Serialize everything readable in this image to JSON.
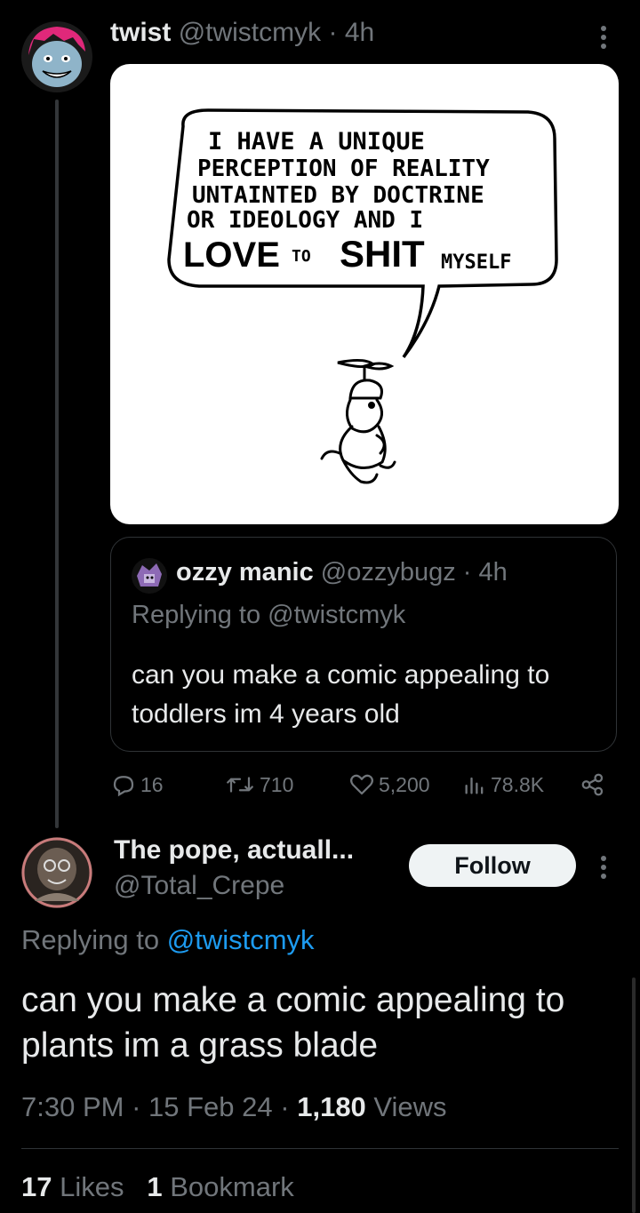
{
  "parent_tweet": {
    "display_name": "twist",
    "handle": "@twistcmyk",
    "separator": "·",
    "time": "4h",
    "avatar": "avatar-blue-face-pink-hair",
    "comic": {
      "speech_lines": [
        "I HAVE A UNIQUE",
        "PERCEPTION OF REALITY",
        "UNTAINTED BY DOCTRINE",
        "OR IDEOLOGY AND I"
      ],
      "speech_big_1": "LOVE",
      "speech_to": "TO",
      "speech_big_2": "SHIT",
      "speech_end": "MYSELF"
    },
    "quote": {
      "display_name": "ozzy manic",
      "handle": "@ozzybugz",
      "separator": "·",
      "time": "4h",
      "replying_prefix": "Replying to",
      "replying_handle": "@twistcmyk",
      "text": "can you make a comic appealing to toddlers im 4 years old"
    },
    "actions": {
      "replies": "16",
      "reposts": "710",
      "likes": "5,200",
      "views": "78.8K"
    }
  },
  "reply_tweet": {
    "display_name": "The pope, actuall...",
    "handle": "@Total_Crepe",
    "follow_label": "Follow",
    "replying_prefix": "Replying to",
    "replying_handle": "@twistcmyk",
    "text": "can you make a comic appealing to plants im a grass blade",
    "time": "7:30 PM",
    "date": "15 Feb 24",
    "separator": "·",
    "views_count": "1,180",
    "views_label": "Views",
    "likes_count": "17",
    "likes_label": "Likes",
    "bookmarks_count": "1",
    "bookmarks_label": "Bookmark"
  },
  "colors": {
    "background": "#000000",
    "text": "#e7e9ea",
    "muted": "#71767b",
    "link": "#1d9bf0",
    "border": "#2f3336"
  }
}
